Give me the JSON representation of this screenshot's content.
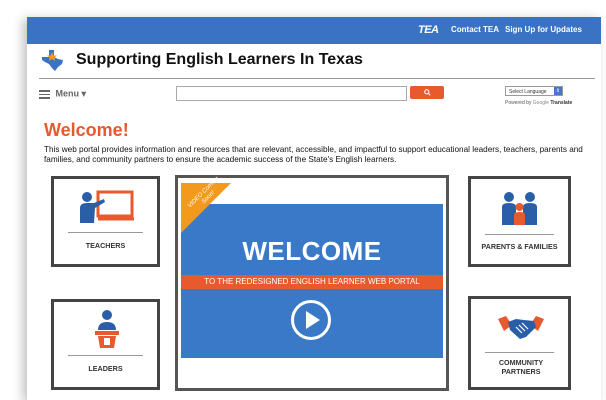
{
  "topbar": {
    "logo_text": "TEA",
    "links": [
      "Contact TEA",
      "Sign Up for Updates"
    ]
  },
  "header": {
    "site_title": "Supporting English Learners In Texas"
  },
  "nav": {
    "menu_label": "Menu",
    "search_button_icon": "search-icon",
    "language_select_value": "Select Language",
    "powered_by": "Powered by",
    "google": "Google",
    "translate": "Translate"
  },
  "welcome": {
    "heading": "Welcome!",
    "intro": "This web portal provides information and resources that are relevant, accessible, and impactful to support educational leaders, teachers, parents and families, and community partners to ensure the academic success of the State's English learners."
  },
  "cards": {
    "teachers": "TEACHERS",
    "leaders": "LEADERS",
    "parents": "PARENTS & FAMILIES",
    "community": "COMMUNITY PARTNERS"
  },
  "video": {
    "ribbon": "VIDEO Coming Soon!",
    "title": "WELCOME",
    "subtitle": "TO THE REDESIGNED ENGLISH LEARNER WEB PORTAL"
  },
  "colors": {
    "topbar": "#3a73c4",
    "accent": "#e8592d",
    "video_bg": "#3a79c7",
    "ribbon": "#f39a1e"
  }
}
